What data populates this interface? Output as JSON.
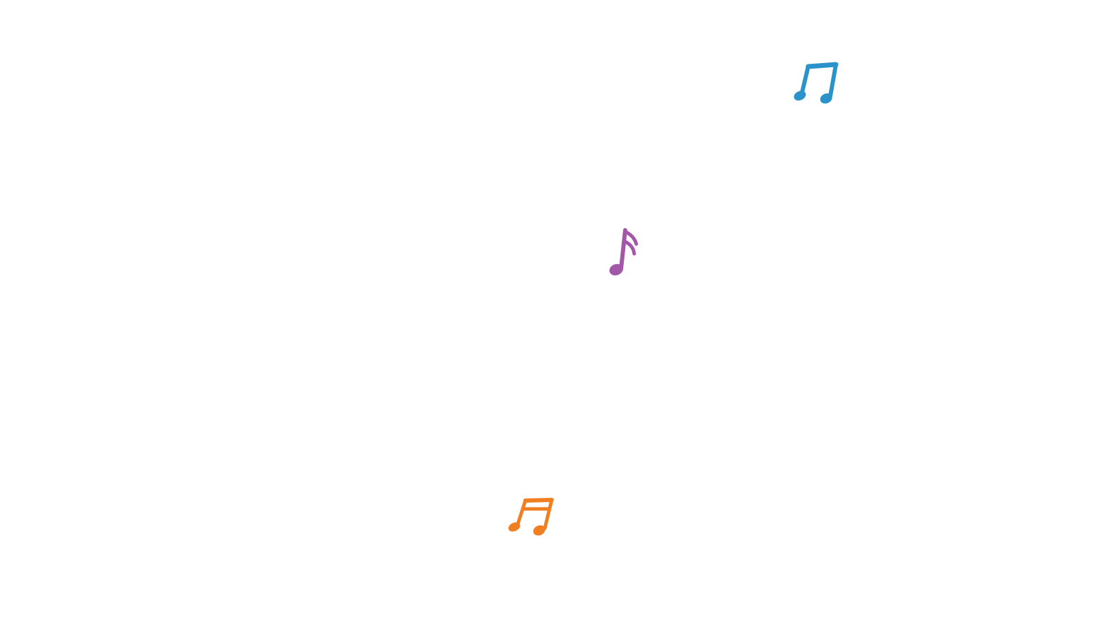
{
  "canvas": {
    "background": "#ffffff"
  },
  "notes": [
    {
      "icon": "beamed-eighth-notes-icon",
      "color": "#2a93c9"
    },
    {
      "icon": "sixteenth-note-icon",
      "color": "#a357a8"
    },
    {
      "icon": "beamed-sixteenth-notes-icon",
      "color": "#f07f22"
    }
  ]
}
